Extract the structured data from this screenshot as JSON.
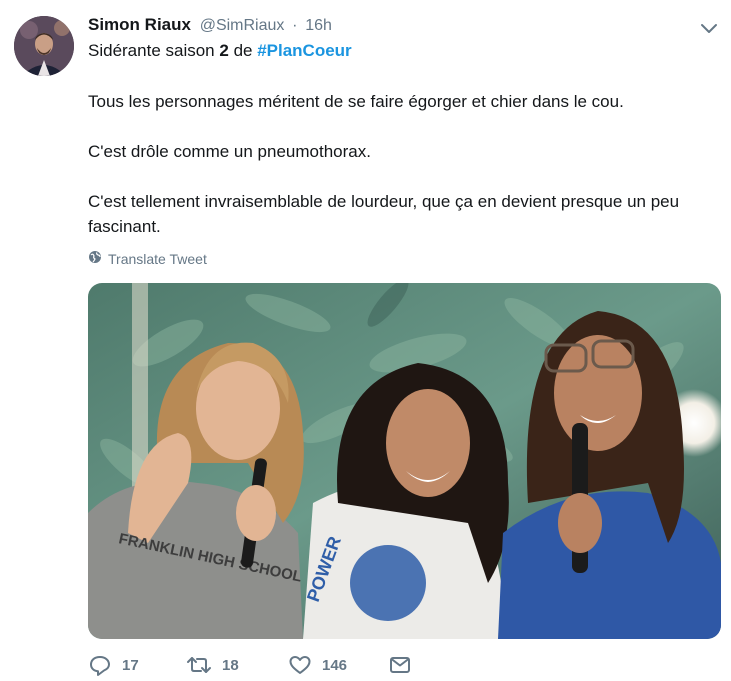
{
  "tweet": {
    "author_name": "Simon Riaux",
    "handle": "@SimRiaux",
    "separator": "·",
    "time": "16h",
    "subtitle_prefix": "Sidérante saison ",
    "subtitle_bold": "2",
    "subtitle_mid": " de ",
    "hashtag": "#PlanCoeur",
    "paragraphs": [
      "Tous les personnages méritent de se faire égorger et chier dans le cou.",
      "C'est drôle comme un pneumothorax.",
      "C'est tellement invraisemblable de lourdeur, que ça en devient presque un peu fascinant."
    ],
    "translate_label": "Translate Tweet",
    "media_shirt_text_1": "FRANKLIN HIGH SCHOOL",
    "media_shirt_text_2": "POWER"
  },
  "actions": {
    "reply_count": "17",
    "retweet_count": "18",
    "like_count": "146"
  },
  "colors": {
    "text": "#14171a",
    "secondary": "#657786",
    "link": "#1b95e0"
  },
  "icons": [
    "avatar",
    "chevron-down-icon",
    "globe-icon",
    "reply-icon",
    "retweet-icon",
    "heart-icon",
    "mail-icon"
  ]
}
